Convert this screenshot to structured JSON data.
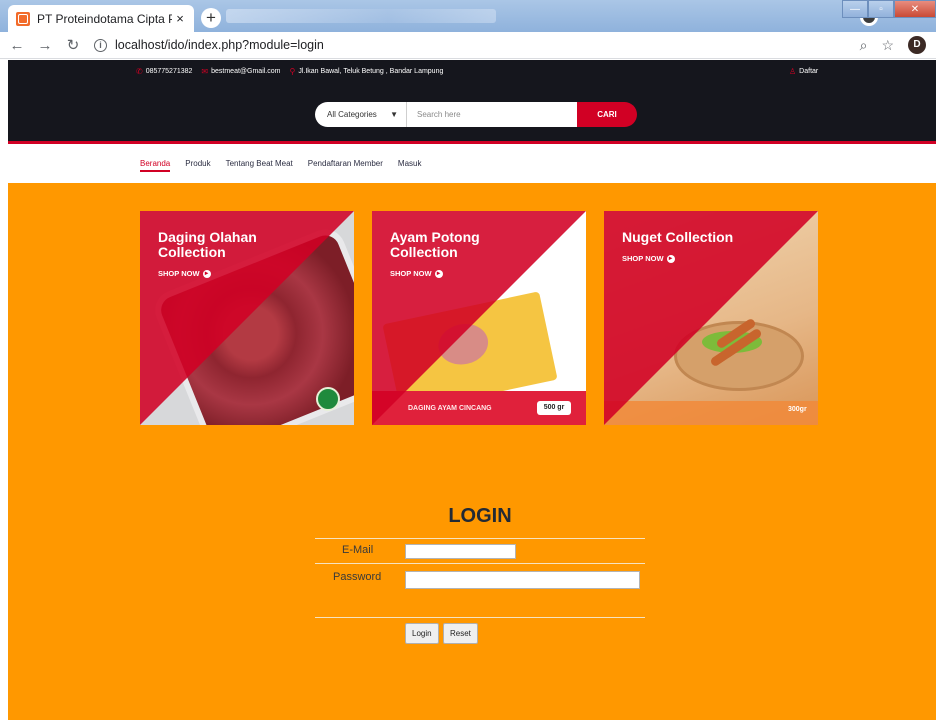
{
  "browser": {
    "tab_title": "PT Proteindotama Cipta Pangan",
    "tab_close": "×",
    "new_tab": "+",
    "url": "localhost/ido/index.php?module=login",
    "avatar_letter": "D",
    "icons": [
      "back-icon",
      "forward-icon",
      "reload-icon",
      "info-icon",
      "zoom-icon",
      "star-icon"
    ]
  },
  "topbar": {
    "phone": "085775271382",
    "email": "bestmeat@Gmail.com",
    "address": "Jl.Ikan Bawal, Teluk Betung , Bandar Lampung",
    "register": "Daftar"
  },
  "search": {
    "category": "All Categories",
    "placeholder": "Search here",
    "button": "CARI"
  },
  "nav": {
    "items": [
      "Beranda",
      "Produk",
      "Tentang Beat Meat",
      "Pendaftaran Member",
      "Masuk"
    ],
    "active": "Beranda"
  },
  "banners": [
    {
      "title": "Daging Olahan Collection",
      "cta": "SHOP NOW"
    },
    {
      "title": "Ayam Potong Collection",
      "cta": "SHOP NOW",
      "band_text": "DAGING AYAM CINCANG",
      "weight": "500 gr"
    },
    {
      "title": "Nuget Collection",
      "cta": "SHOP NOW",
      "weight": "300gr"
    }
  ],
  "login": {
    "title": "LOGIN",
    "email_label": "E-Mail",
    "password_label": "Password",
    "login_button": "Login",
    "reset_button": "Reset"
  },
  "colors": {
    "accent": "#d10024",
    "dark": "#15161d",
    "background": "#ff9800"
  }
}
